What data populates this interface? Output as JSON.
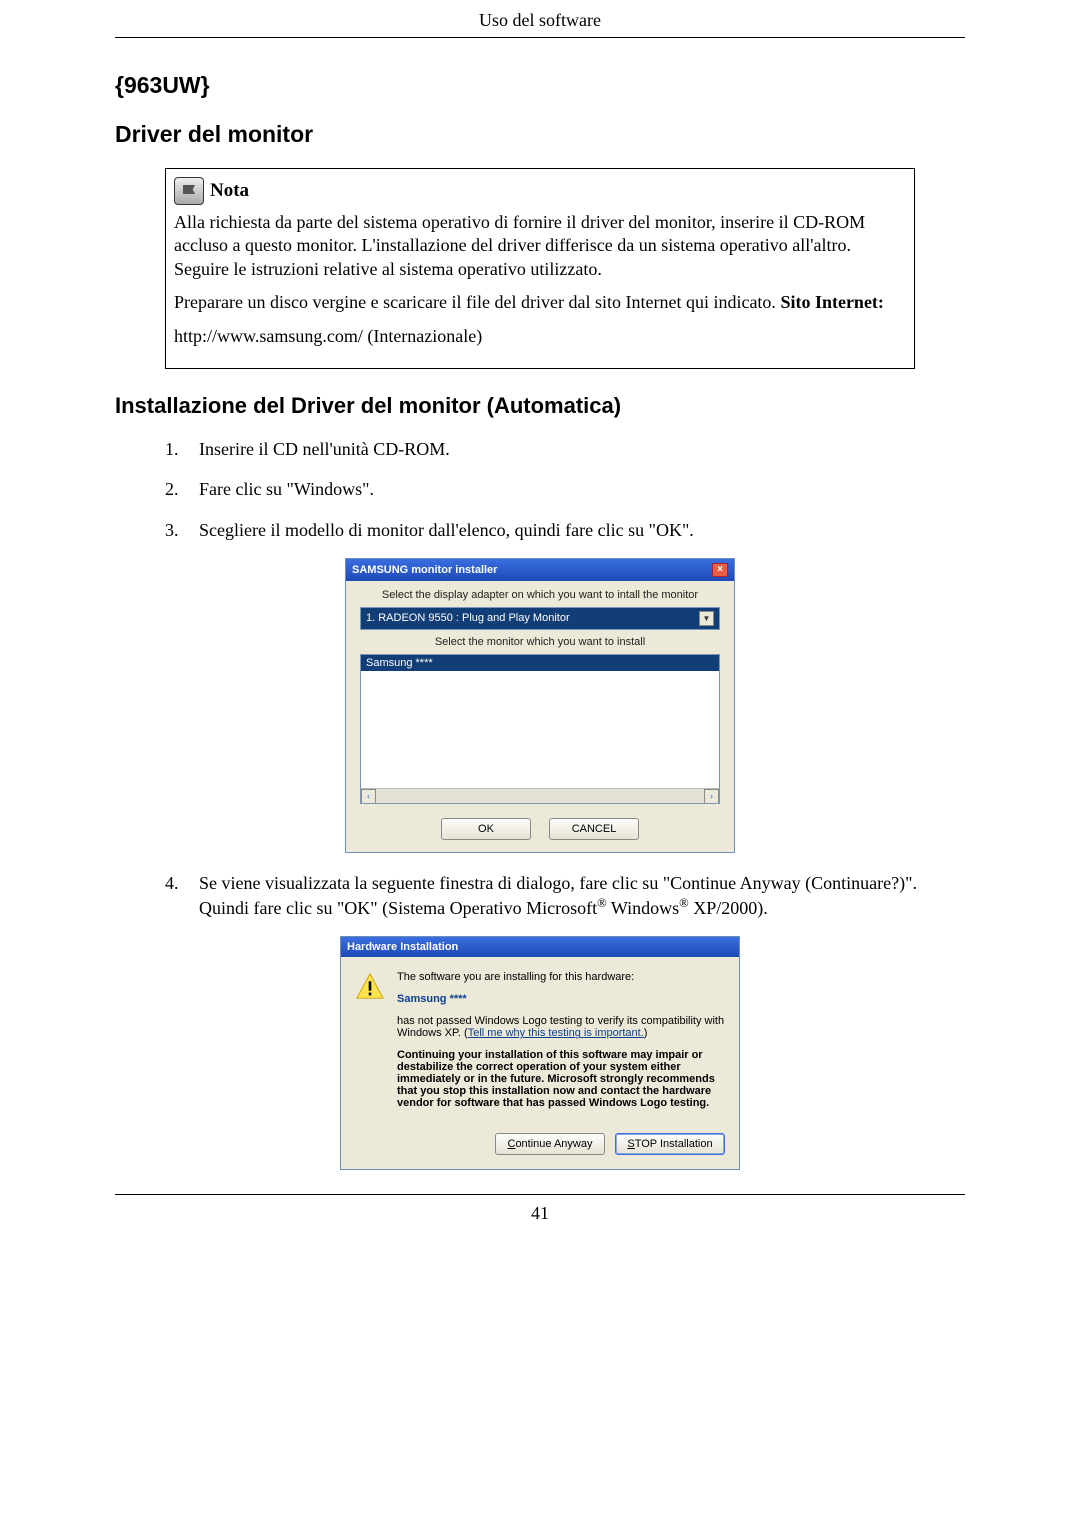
{
  "header": {
    "title": "Uso del software"
  },
  "section_model": "{963UW}",
  "section_driver": "Driver del monitor",
  "note": {
    "title": "Nota",
    "para1": "Alla richiesta da parte del sistema operativo di fornire il driver del monitor, inserire il CD-ROM accluso a questo monitor. L'installazione del driver differisce da un sistema operativo all'altro. Seguire le istruzioni relative al sistema operativo utilizzato.",
    "para2_prefix": "Preparare un disco vergine e scaricare il file del driver dal sito Internet qui indicato.",
    "para2_label": "Sito Internet:",
    "url": "http://www.samsung.com/ (Internazionale)"
  },
  "section_install": "Installazione del Driver del monitor (Automatica)",
  "steps": {
    "s1": "Inserire il CD nell'unità CD-ROM.",
    "s2": "Fare clic su \"Windows\".",
    "s3": "Scegliere il modello di monitor dall'elenco, quindi fare clic su \"OK\".",
    "s4_pre": "Se viene visualizzata la seguente finestra di dialogo, fare clic su \"Continue Anyway (Continuare?)\". Quindi fare clic su \"OK\" (Sistema Operativo Microsoft",
    "s4_reg1": "®",
    "s4_mid": " Windows",
    "s4_reg2": "®",
    "s4_post": " XP/2000).",
    "num1": "1.",
    "num2": "2.",
    "num3": "3.",
    "num4": "4."
  },
  "installer": {
    "title": "SAMSUNG monitor installer",
    "label1": "Select the display adapter on which you want to intall the monitor",
    "combo": "1. RADEON 9550 : Plug and Play Monitor",
    "label2": "Select the monitor which you want to install",
    "list_item": "Samsung ****",
    "btn_ok": "OK",
    "btn_cancel": "CANCEL"
  },
  "hwdlg": {
    "title": "Hardware Installation",
    "line1": "The software you are installing for this hardware:",
    "samsung": "Samsung ****",
    "compat": "has not passed Windows Logo testing to verify its compatibility with Windows XP. (",
    "link": "Tell me why this testing is important.",
    "compat_close": ")",
    "bold": "Continuing your installation of this software may impair or destabilize the correct operation of your system either immediately or in the future. Microsoft strongly recommends that you stop this installation now and contact the hardware vendor for software that has passed Windows Logo testing.",
    "btn_continue_u": "C",
    "btn_continue_rest": "ontinue Anyway",
    "btn_stop_u": "S",
    "btn_stop_rest": "TOP Installation"
  },
  "footer": {
    "page_num": "41"
  }
}
